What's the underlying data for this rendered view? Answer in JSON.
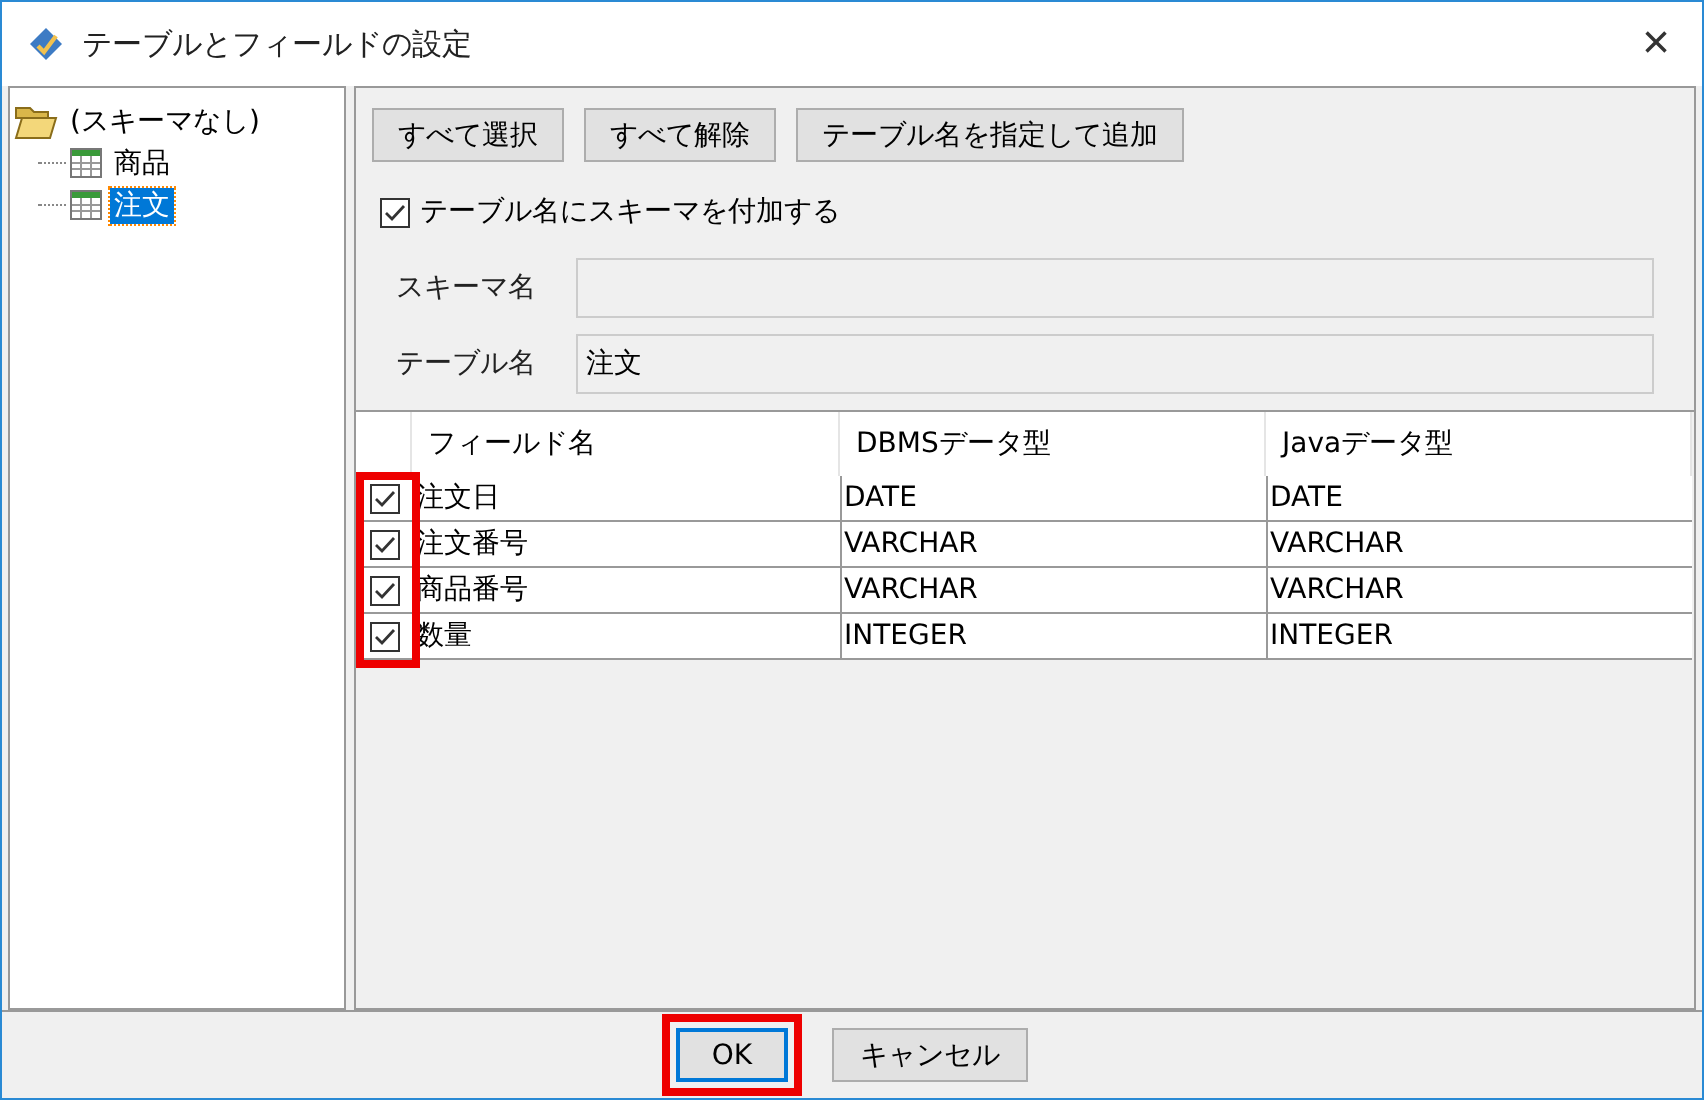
{
  "window": {
    "title": "テーブルとフィールドの設定",
    "close": "×"
  },
  "tree": {
    "root": {
      "label": "(スキーマなし)",
      "expanded": true,
      "children": [
        {
          "label": "商品",
          "selected": false
        },
        {
          "label": "注文",
          "selected": true
        }
      ]
    }
  },
  "toolbar": {
    "buttons": [
      "すべて選択",
      "すべて解除",
      "テーブル名を指定して追加"
    ]
  },
  "schema_option": {
    "label": "テーブル名にスキーマを付加する",
    "checked": true
  },
  "fields": [
    {
      "label": "スキーマ名"
    },
    {
      "label": "テーブル名",
      "value": "注文"
    }
  ],
  "table": {
    "columns": [
      "フィールド名",
      "DBMSデータ型",
      "Javaデータ型"
    ],
    "checkbox_column_highlighted": true,
    "rows": [
      {
        "checked": true,
        "cells": [
          "注文日",
          "DATE",
          "DATE"
        ]
      },
      {
        "checked": true,
        "cells": [
          "注文番号",
          "VARCHAR",
          "VARCHAR"
        ]
      },
      {
        "checked": true,
        "cells": [
          "商品番号",
          "VARCHAR",
          "VARCHAR"
        ]
      },
      {
        "checked": true,
        "cells": [
          "数量",
          "INTEGER",
          "INTEGER"
        ]
      }
    ]
  },
  "footer": {
    "buttons": [
      {
        "label": "OK",
        "default": true,
        "highlighted": true
      },
      {
        "label": "キャンセル",
        "default": false,
        "highlighted": false
      }
    ]
  }
}
